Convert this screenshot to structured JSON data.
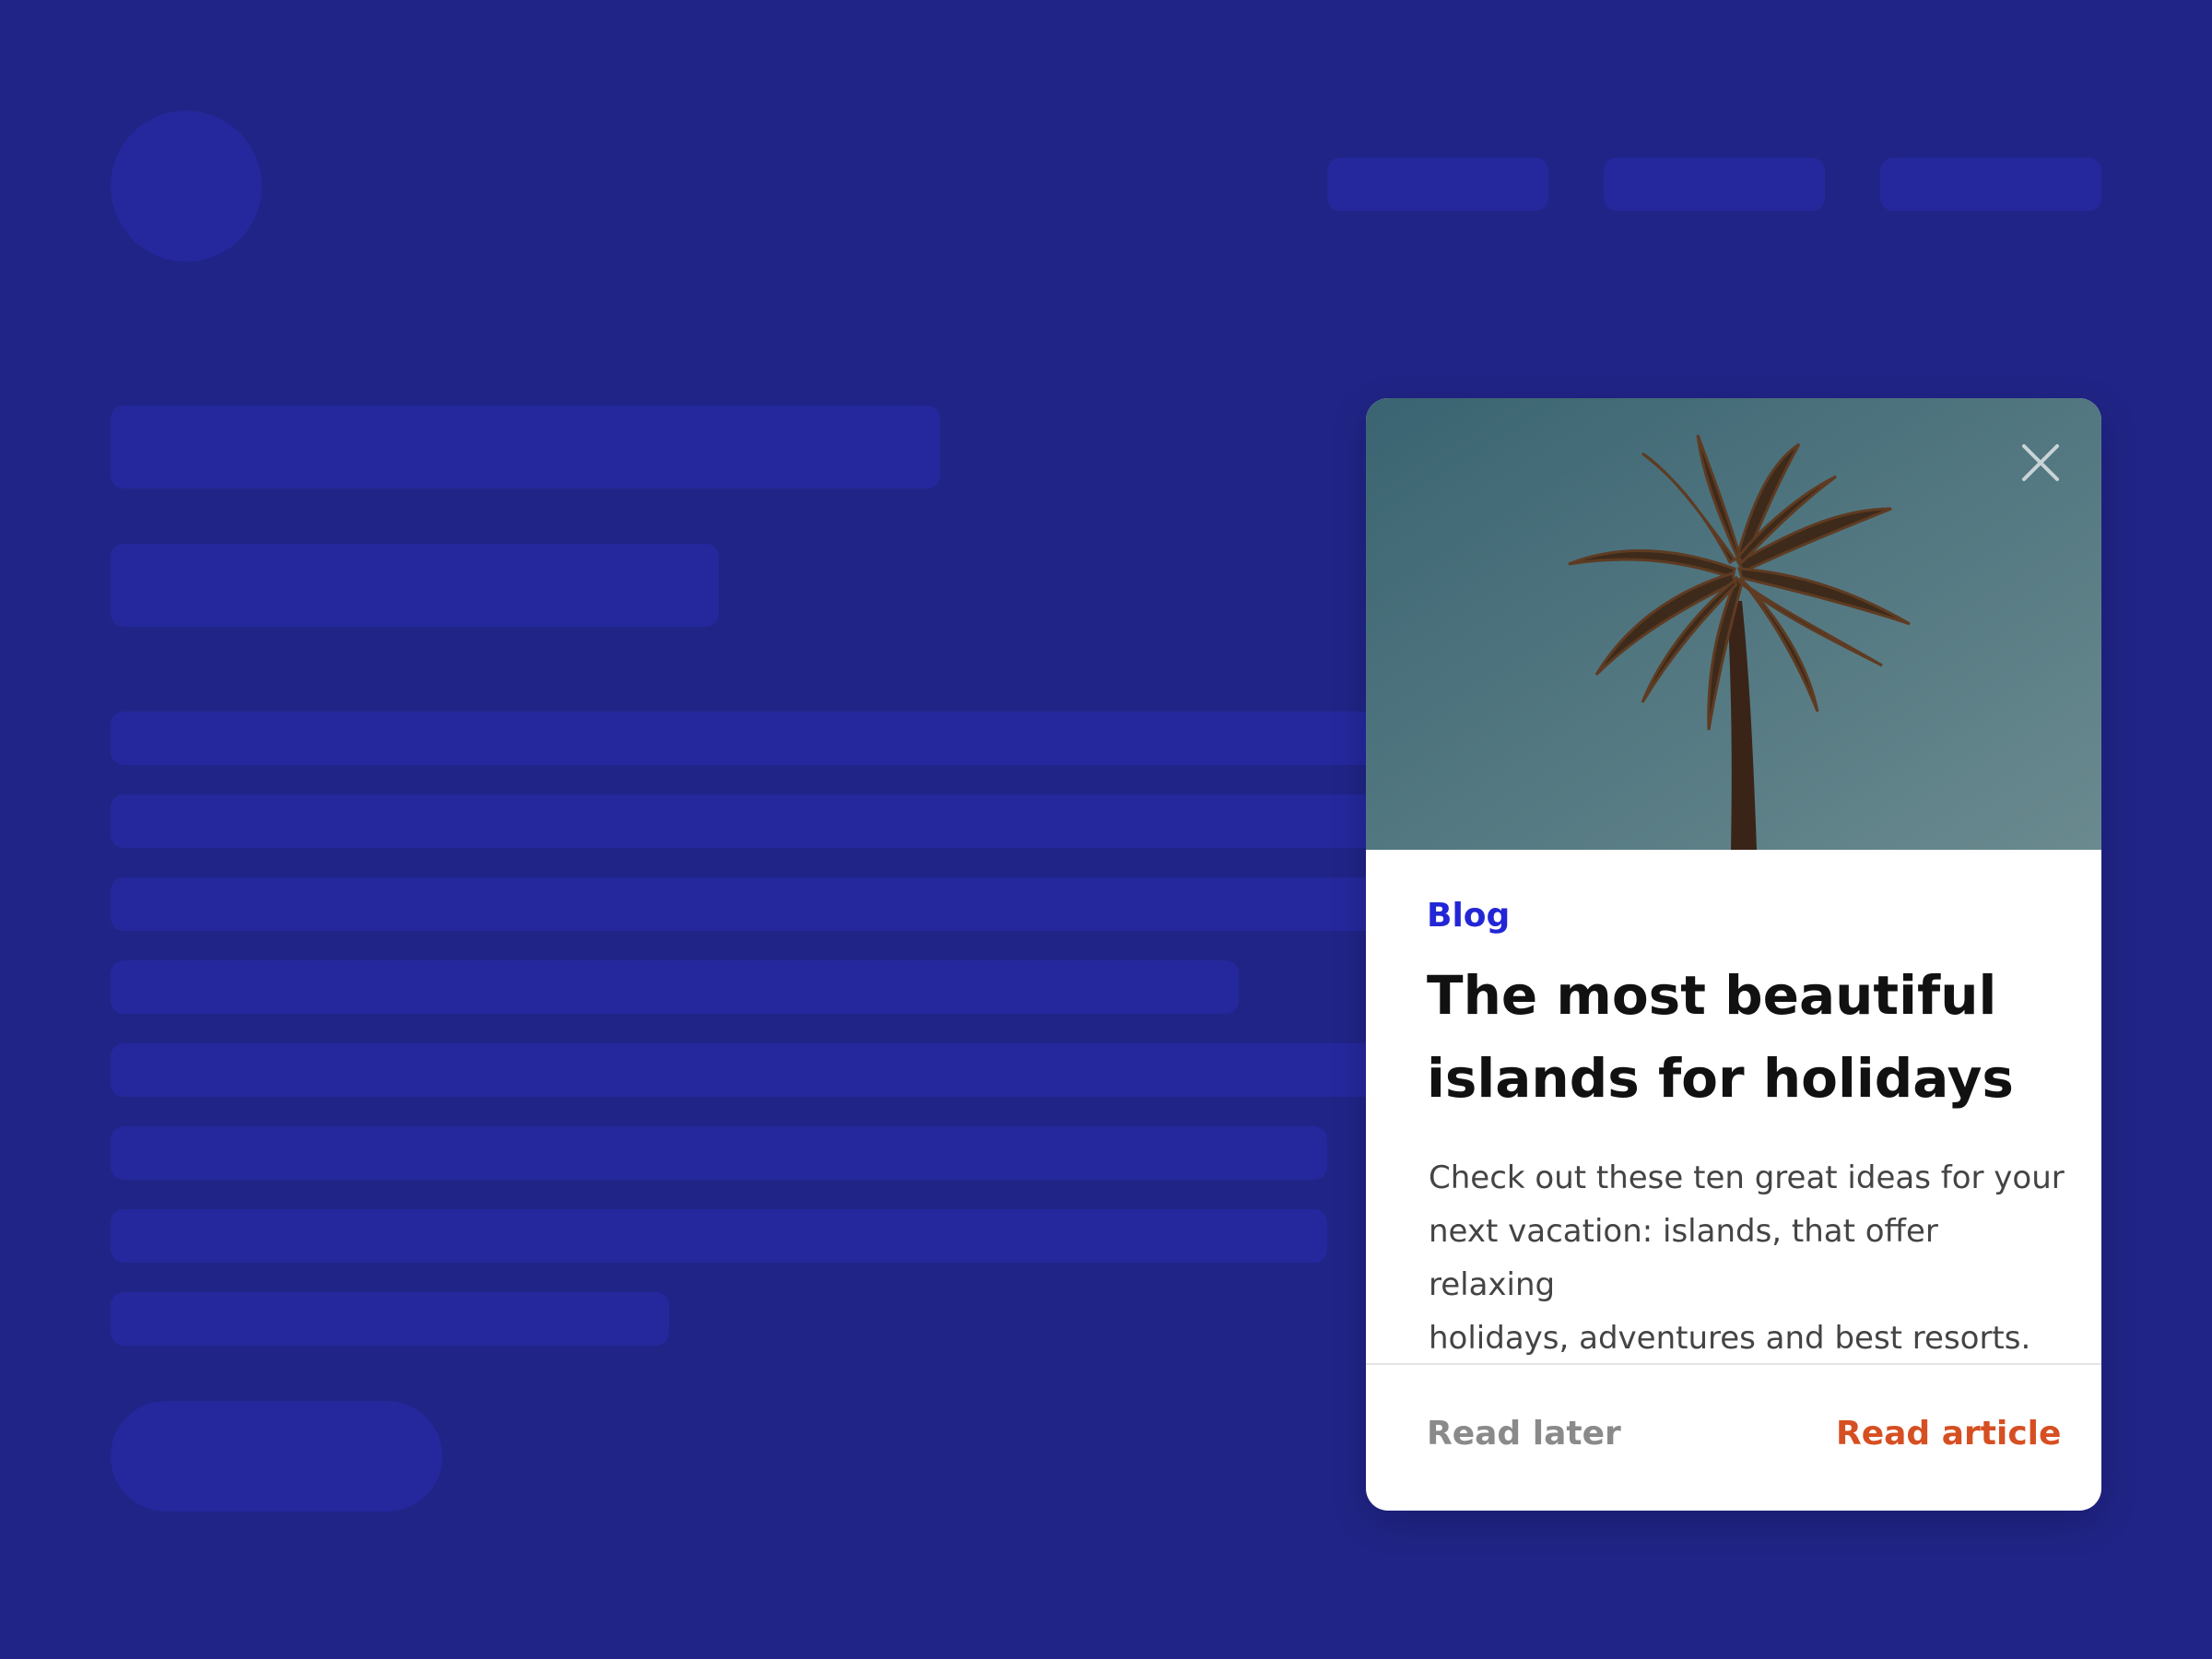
{
  "colors": {
    "background": "#202486",
    "skeleton": "#24289c",
    "card_background": "#ffffff",
    "eyebrow": "#2326d6",
    "title": "#111111",
    "description": "#444444",
    "read_later": "#8a8a8a",
    "read_article": "#d64f22",
    "sky_top": "#3a6472",
    "sky_bottom": "#6a8a8f"
  },
  "card": {
    "category": "Blog",
    "title_line1": "The most beautiful",
    "title_line2": "islands for holidays",
    "description_line1": "Check out these ten great ideas for your",
    "description_line2": "next vacation: islands, that offer relaxing",
    "description_line3": "holidays, adventures and best resorts.",
    "read_later_label": "Read later",
    "read_article_label": "Read article",
    "close_icon": "close-icon",
    "image": "palm-tree"
  }
}
